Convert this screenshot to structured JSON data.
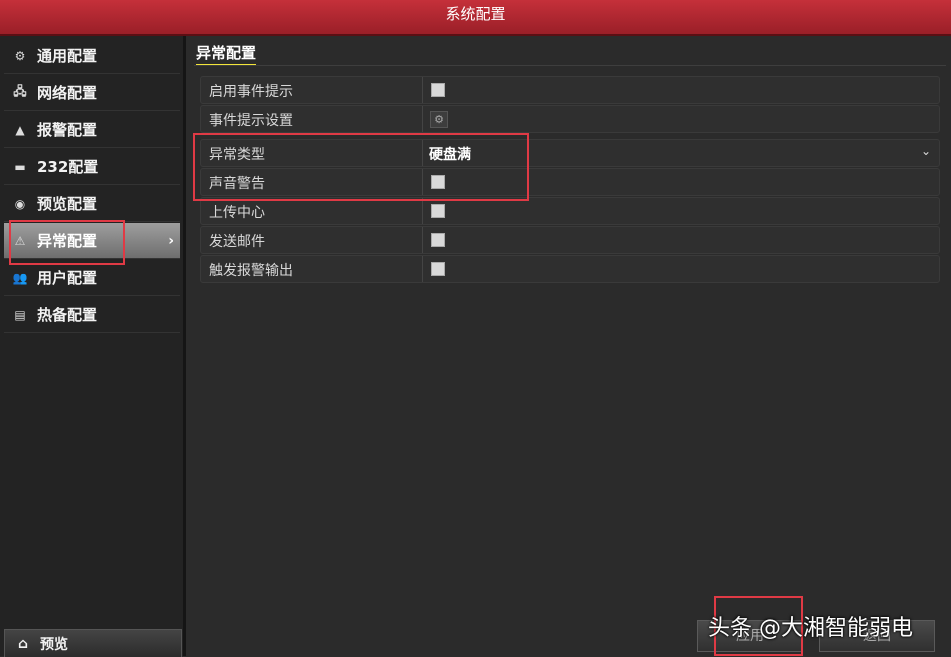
{
  "window": {
    "title": "系统配置"
  },
  "sidebar": {
    "items": [
      {
        "label": "通用配置",
        "icon": "gear-icon",
        "glyph": "⚙"
      },
      {
        "label": "网络配置",
        "icon": "network-icon",
        "glyph": "🖧"
      },
      {
        "label": "报警配置",
        "icon": "bell-icon",
        "glyph": "▲"
      },
      {
        "label": "232配置",
        "icon": "serial-port-icon",
        "glyph": "▬"
      },
      {
        "label": "预览配置",
        "icon": "eye-icon",
        "glyph": "◉"
      },
      {
        "label": "异常配置",
        "icon": "warning-icon",
        "glyph": "⚠",
        "active": true
      },
      {
        "label": "用户配置",
        "icon": "users-icon",
        "glyph": "👥"
      },
      {
        "label": "热备配置",
        "icon": "backup-icon",
        "glyph": "▤"
      }
    ],
    "bottom": {
      "label": "预览",
      "icon": "home-icon",
      "glyph": "⌂"
    }
  },
  "main": {
    "section_title": "异常配置",
    "rows": [
      {
        "label": "启用事件提示",
        "control": "checkbox"
      },
      {
        "label": "事件提示设置",
        "control": "gear-button"
      },
      {
        "label": "异常类型",
        "control": "select",
        "value": "硬盘满"
      },
      {
        "label": "声音警告",
        "control": "checkbox"
      },
      {
        "label": "上传中心",
        "control": "checkbox"
      },
      {
        "label": "发送邮件",
        "control": "checkbox"
      },
      {
        "label": "触发报警输出",
        "control": "checkbox"
      }
    ]
  },
  "footer": {
    "apply_label": "应用",
    "back_label": "返回"
  },
  "watermark": "头条 @大湘智能弱电",
  "colors": {
    "title_bar": "#b0262f",
    "highlight": "#e03a45",
    "section_underline": "#f3e53a"
  }
}
